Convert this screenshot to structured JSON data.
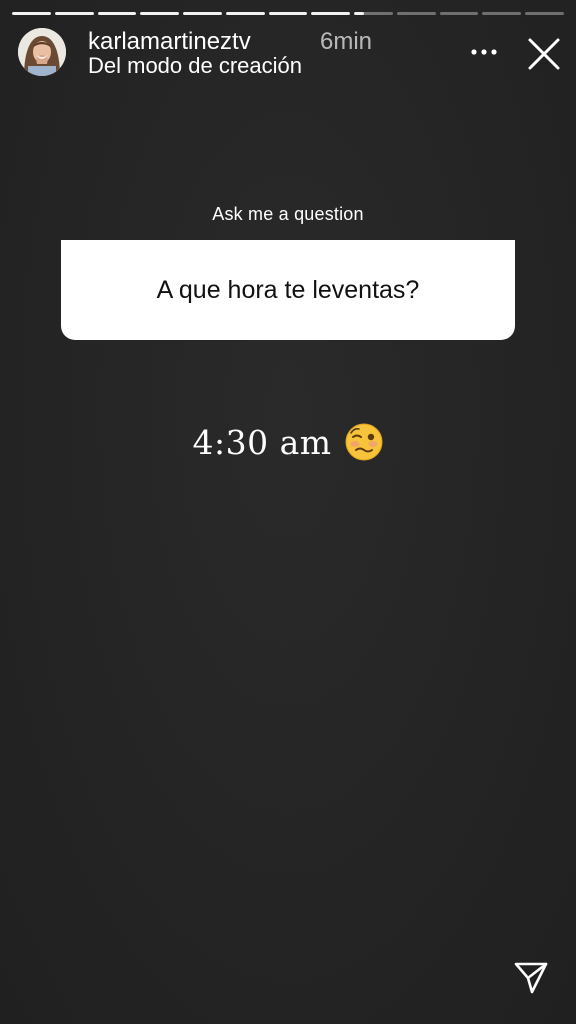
{
  "story": {
    "progress": {
      "segments": 13,
      "completed": 8,
      "current_fraction": 0.25
    },
    "header": {
      "username": "karlamartineztv",
      "time": "6min",
      "subtitle": "Del modo de creación",
      "icons": {
        "more": "more-horizontal-icon",
        "close": "close-icon",
        "avatar": "profile-avatar"
      }
    },
    "question": {
      "prompt": "Ask me a question",
      "text": "A que hora te leventas?"
    },
    "answer": {
      "text": "4:30 am",
      "emoji_icon": "woozy-face-icon"
    },
    "footer": {
      "share_icon": "direct-send-icon"
    }
  }
}
